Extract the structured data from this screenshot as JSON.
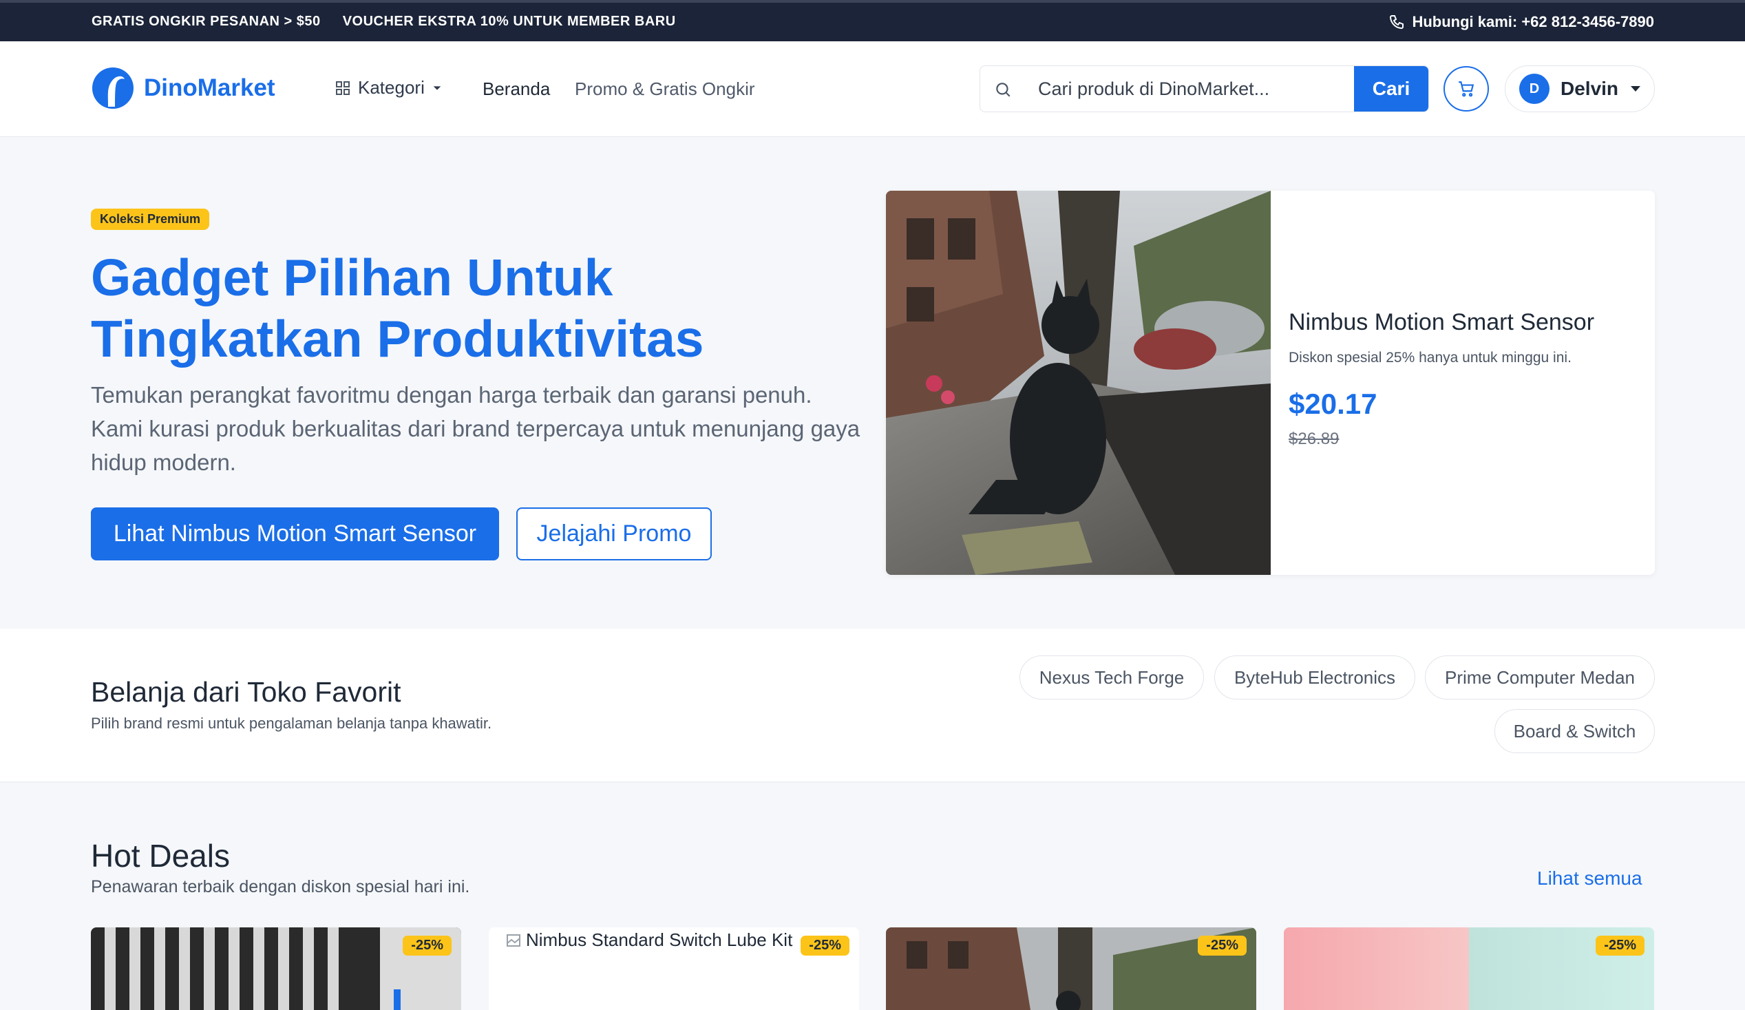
{
  "topbar": {
    "promo_1": "GRATIS ONGKIR PESANAN > $50",
    "promo_2": "VOUCHER EKSTRA 10% UNTUK MEMBER BARU",
    "contact": "Hubungi kami: +62 812-3456-7890"
  },
  "header": {
    "brand": "DinoMarket",
    "kategori": "Kategori",
    "nav_home": "Beranda",
    "nav_promo": "Promo & Gratis Ongkir",
    "search_placeholder": "Cari produk di DinoMarket...",
    "search_button": "Cari",
    "user_initial": "D",
    "user_name": "Delvin"
  },
  "hero": {
    "badge": "Koleksi Premium",
    "title": "Gadget Pilihan Untuk Tingkatkan Produktivitas",
    "description": "Temukan perangkat favoritmu dengan harga terbaik dan garansi penuh. Kami kurasi produk berkualitas dari brand terpercaya untuk menunjang gaya hidup modern.",
    "primary_button": "Lihat Nimbus Motion Smart Sensor",
    "secondary_button": "Jelajahi Promo"
  },
  "featured": {
    "name": "Nimbus Motion Smart Sensor",
    "subtitle": "Diskon spesial 25% hanya untuk minggu ini.",
    "price": "$20.17",
    "old_price": "$26.89"
  },
  "stores": {
    "title": "Belanja dari Toko Favorit",
    "subtitle": "Pilih brand resmi untuk pengalaman belanja tanpa khawatir.",
    "items": [
      "Nexus Tech Forge",
      "ByteHub Electronics",
      "Prime Computer Medan",
      "Board & Switch"
    ]
  },
  "deals": {
    "title": "Hot Deals",
    "subtitle": "Penawaran terbaik dengan diskon spesial hari ini.",
    "see_all": "Lihat semua",
    "cards": [
      {
        "discount": "-25%",
        "image": "radiator-photo"
      },
      {
        "discount": "-25%",
        "alt": "Nimbus Standard Switch Lube Kit"
      },
      {
        "discount": "-25%",
        "image": "street-cat-photo"
      },
      {
        "discount": "-25%",
        "image": "pastel-gradient"
      }
    ]
  },
  "colors": {
    "accent": "#1a6ee8",
    "topbar_bg": "#1b2438",
    "badge": "#fcc419"
  }
}
